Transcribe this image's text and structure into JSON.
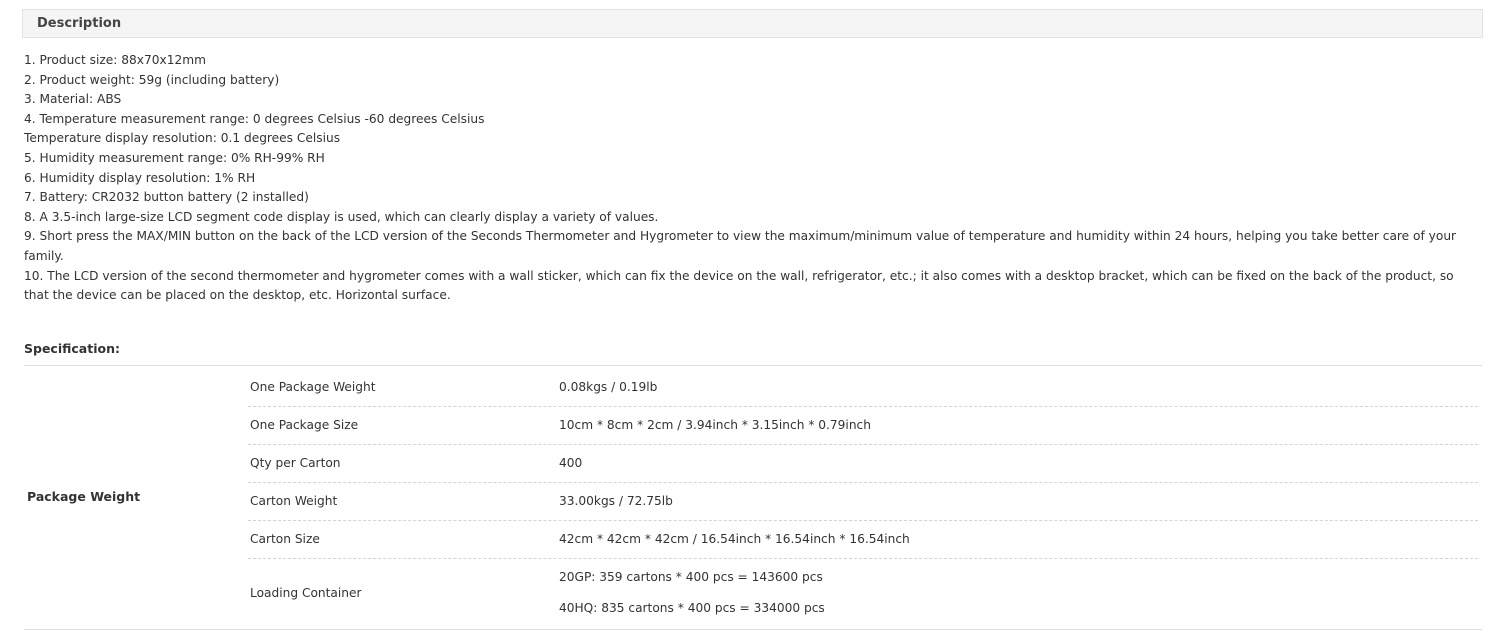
{
  "description": {
    "header_title": "Description",
    "lines": [
      "1. Product size: 88x70x12mm",
      "2. Product weight: 59g (including battery)",
      "3. Material: ABS",
      "4. Temperature measurement range: 0 degrees Celsius -60 degrees Celsius",
      "Temperature display resolution: 0.1 degrees Celsius",
      "5. Humidity measurement range: 0% RH-99% RH",
      "6. Humidity display resolution: 1% RH",
      "7. Battery: CR2032 button battery (2 installed)",
      "8. A 3.5-inch large-size LCD segment code display is used, which can clearly display a variety of values.",
      "9. Short press the MAX/MIN button on the back of the LCD version of the Seconds Thermometer and Hygrometer to view the maximum/minimum value of temperature and humidity within 24 hours, helping you take better care of your family.",
      "10. The LCD version of the second thermometer and hygrometer comes with a wall sticker, which can fix the device on the wall, refrigerator, etc.; it also comes with a desktop bracket, which can be fixed on the back of the product, so that the device can be placed on the desktop, etc. Horizontal surface."
    ]
  },
  "specification": {
    "title": "Specification:",
    "group_label": "Package Weight",
    "rows": [
      {
        "key": "One Package Weight",
        "values": [
          "0.08kgs / 0.19lb"
        ]
      },
      {
        "key": "One Package Size",
        "values": [
          "10cm * 8cm * 2cm / 3.94inch * 3.15inch * 0.79inch"
        ]
      },
      {
        "key": "Qty per Carton",
        "values": [
          "400"
        ]
      },
      {
        "key": "Carton Weight",
        "values": [
          "33.00kgs / 72.75lb"
        ]
      },
      {
        "key": "Carton Size",
        "values": [
          "42cm * 42cm * 42cm / 16.54inch * 16.54inch * 16.54inch"
        ]
      },
      {
        "key": "Loading Container",
        "values": [
          "20GP: 359 cartons * 400 pcs = 143600 pcs",
          "40HQ: 835 cartons * 400 pcs = 334000 pcs"
        ]
      }
    ]
  }
}
